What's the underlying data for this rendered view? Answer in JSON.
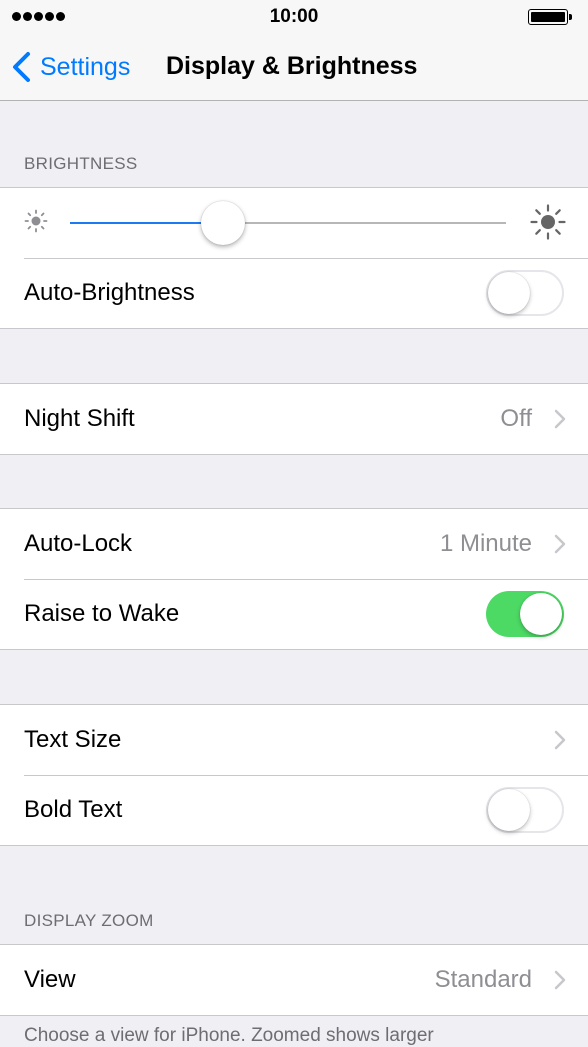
{
  "status_bar": {
    "time": "10:00",
    "signal_icon": "signal-dots-icon",
    "battery_icon": "battery-full-icon"
  },
  "nav": {
    "back_label": "Settings",
    "back_icon": "chevron-left-icon",
    "title": "Display & Brightness"
  },
  "colors": {
    "accent": "#007aff",
    "toggle_on": "#4cd964",
    "background": "#efeff4"
  },
  "brightness": {
    "header": "BRIGHTNESS",
    "slider_value": 0.35,
    "min_icon": "sun-small-icon",
    "max_icon": "sun-large-icon",
    "auto_label": "Auto-Brightness",
    "auto_on": false
  },
  "night_shift": {
    "label": "Night Shift",
    "value": "Off"
  },
  "lock": {
    "auto_lock_label": "Auto-Lock",
    "auto_lock_value": "1 Minute",
    "raise_label": "Raise to Wake",
    "raise_on": true
  },
  "text": {
    "size_label": "Text Size",
    "bold_label": "Bold Text",
    "bold_on": false
  },
  "zoom": {
    "header": "DISPLAY ZOOM",
    "view_label": "View",
    "view_value": "Standard",
    "footer": "Choose a view for iPhone. Zoomed shows larger"
  }
}
